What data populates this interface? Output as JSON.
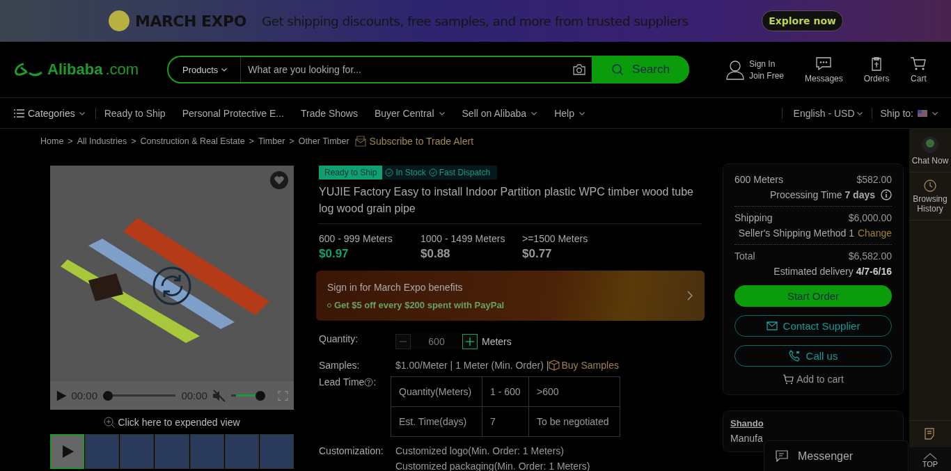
{
  "banner": {
    "brand": "MARCH EXPO",
    "tagline": "Get shipping discounts, free samples, and more from trusted suppliers",
    "button": "Explore now"
  },
  "header": {
    "logo": {
      "name": "Alibaba",
      "suffix": ".com"
    },
    "search": {
      "category": "Products",
      "placeholder": "What are you looking for...",
      "button": "Search"
    },
    "account": {
      "sign_in": "Sign In",
      "join": "Join Free"
    },
    "actions": [
      {
        "kind": "messages",
        "label": "Messages"
      },
      {
        "kind": "orders",
        "label": "Orders"
      },
      {
        "kind": "cart",
        "label": "Cart"
      }
    ]
  },
  "nav": {
    "categories": "Categories",
    "items": [
      {
        "label": "Ready to Ship",
        "dropdown": false
      },
      {
        "label": "Personal Protective E...",
        "dropdown": false
      },
      {
        "label": "Trade Shows",
        "dropdown": false
      },
      {
        "label": "Buyer Central",
        "dropdown": true
      },
      {
        "label": "Sell on Alibaba",
        "dropdown": true
      },
      {
        "label": "Help",
        "dropdown": true
      }
    ],
    "language": "English - USD",
    "ship_to": "Ship to:"
  },
  "breadcrumbs": {
    "separator": ">",
    "items": [
      "Home",
      "All Industries",
      "Construction & Real Estate",
      "Timber",
      "Other Timber"
    ]
  },
  "subscribe": "Subscribe to Trade Alert",
  "gallery": {
    "video": {
      "current": "00:00",
      "total": "00:00",
      "progress": {
        "level": 0
      },
      "muted": true,
      "volume": {
        "level": 1
      }
    },
    "expand": "Click here to expended view",
    "thumbnails": [
      {
        "kind": "video",
        "selected": true
      },
      {
        "kind": "image",
        "selected": false
      },
      {
        "kind": "image",
        "selected": false
      },
      {
        "kind": "image",
        "selected": false
      },
      {
        "kind": "image",
        "selected": false
      },
      {
        "kind": "image",
        "selected": false
      },
      {
        "kind": "image",
        "selected": false
      }
    ]
  },
  "product": {
    "badges": {
      "ready": "Ready to Ship",
      "features": [
        "In Stock",
        "Fast Dispatch"
      ]
    },
    "title": "YUJIE Factory Easy to install Indoor Partition plastic WPC timber wood tube log wood grain pipe",
    "tiers": [
      {
        "range": "600 - 999 Meters",
        "price": "$0.97",
        "selected": true
      },
      {
        "range": "1000 - 1499 Meters",
        "price": "$0.88",
        "selected": false
      },
      {
        "range": ">=1500 Meters",
        "price": "$0.77",
        "selected": false
      }
    ],
    "promo": {
      "title": "Sign in for March Expo benefits",
      "benefit": "Get $5 off every $200 spent with PayPal"
    },
    "quantity": {
      "label": "Quantity:",
      "value": "600",
      "unit": "Meters"
    },
    "samples": {
      "label": "Samples:",
      "text": "$1.00/Meter | 1 Meter (Min. Order) |",
      "link": "Buy Samples"
    },
    "lead_time": {
      "label": "Lead Time",
      "suffix": ":",
      "rows": [
        [
          "Quantity(Meters)",
          "1 - 600",
          ">600"
        ],
        [
          "Est. Time(days)",
          "7",
          "To be negotiated"
        ]
      ]
    },
    "customization": {
      "label": "Customization:",
      "items": [
        "Customized logo(Min. Order: 1 Meters)",
        "Customized packaging(Min. Order: 1 Meters)"
      ]
    }
  },
  "order": {
    "quantity": "600 Meters",
    "subtotal": "$582.00",
    "processing": "Processing Time **7 days**",
    "shipping_label": "Shipping",
    "shipping": "$6,000.00",
    "method": "Seller's Shipping Method 1",
    "change": "Change",
    "total_label": "Total",
    "total": "$6,582.00",
    "delivery": "Estimated delivery **4/7-6/16**",
    "start": "Start Order",
    "contact": "Contact Supplier",
    "call": "Call us",
    "cart": "Add to cart"
  },
  "supplier": {
    "name": "Shando",
    "type": "Manufa"
  },
  "rail": {
    "items": [
      {
        "kind": "chat",
        "label": "Chat Now"
      },
      {
        "kind": "history",
        "label": "Browsing History"
      }
    ],
    "top": "TOP"
  },
  "messenger": "Messenger"
}
